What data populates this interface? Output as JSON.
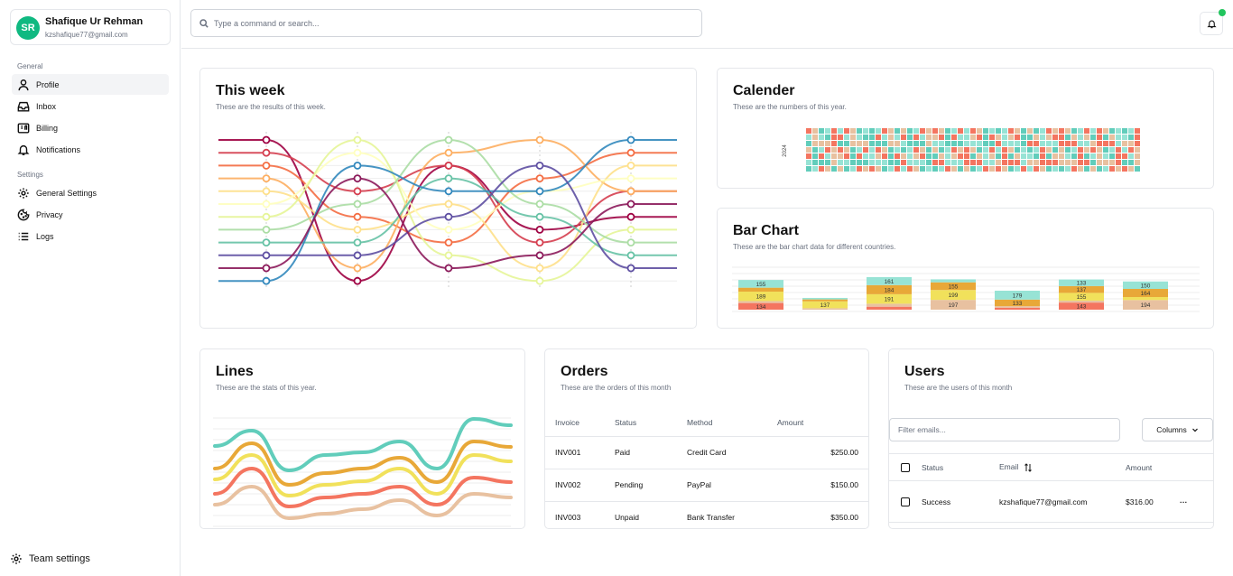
{
  "user": {
    "initials": "SR",
    "name": "Shafique Ur Rehman",
    "email": "kzshafique77@gmail.com"
  },
  "sidebar": {
    "general_label": "General",
    "general_items": [
      {
        "label": "Profile",
        "icon": "user-icon",
        "active": true
      },
      {
        "label": "Inbox",
        "icon": "inbox-icon"
      },
      {
        "label": "Billing",
        "icon": "billing-icon"
      },
      {
        "label": "Notifications",
        "icon": "bell-icon"
      }
    ],
    "settings_label": "Settings",
    "settings_items": [
      {
        "label": "General Settings",
        "icon": "gear-icon"
      },
      {
        "label": "Privacy",
        "icon": "cookie-icon"
      },
      {
        "label": "Logs",
        "icon": "list-icon"
      }
    ],
    "team_settings": "Team settings"
  },
  "topbar": {
    "search_placeholder": "Type a command or search...",
    "notification_dot_color": "#22c55e"
  },
  "this_week": {
    "title": "This week",
    "subtitle": "These are the results of this week."
  },
  "calendar": {
    "title": "Calender",
    "subtitle": "These are the numbers of this year.",
    "year_label": "2024"
  },
  "bar_chart": {
    "title": "Bar Chart",
    "subtitle": "These are the bar chart data for different countries."
  },
  "lines": {
    "title": "Lines",
    "subtitle": "These are the stats of this year."
  },
  "orders": {
    "title": "Orders",
    "subtitle": "These are the orders of this month",
    "columns": [
      "Invoice",
      "Status",
      "Method",
      "Amount"
    ],
    "rows": [
      [
        "INV001",
        "Paid",
        "Credit Card",
        "$250.00"
      ],
      [
        "INV002",
        "Pending",
        "PayPal",
        "$150.00"
      ],
      [
        "INV003",
        "Unpaid",
        "Bank Transfer",
        "$350.00"
      ]
    ]
  },
  "users": {
    "title": "Users",
    "subtitle": "These are the users of this month",
    "filter_placeholder": "Filter emails...",
    "columns_button": "Columns",
    "columns": [
      "Status",
      "Email",
      "Amount"
    ],
    "rows": [
      {
        "status": "Success",
        "email": "kzshafique77@gmail.com",
        "amount": "$316.00",
        "menu": "···"
      }
    ]
  },
  "chart_data": [
    {
      "type": "line",
      "chart": "bump",
      "x": [
        "1",
        "2",
        "3",
        "4",
        "5"
      ],
      "ranks": 12,
      "series": [
        {
          "color": "#9e0142",
          "values": [
            1,
            12,
            3,
            8,
            7
          ]
        },
        {
          "color": "#d53e4f",
          "values": [
            2,
            5,
            3,
            9,
            5
          ]
        },
        {
          "color": "#f46d43",
          "values": [
            3,
            7,
            9,
            4,
            2
          ]
        },
        {
          "color": "#fdae61",
          "values": [
            4,
            11,
            2,
            1,
            5
          ]
        },
        {
          "color": "#fee08b",
          "values": [
            5,
            8,
            6,
            11,
            3
          ]
        },
        {
          "color": "#ffffbf",
          "values": [
            6,
            2,
            8,
            5,
            4
          ]
        },
        {
          "color": "#e6f598",
          "values": [
            7,
            1,
            10,
            12,
            8
          ]
        },
        {
          "color": "#abdda4",
          "values": [
            8,
            6,
            1,
            6,
            9
          ]
        },
        {
          "color": "#66c2a5",
          "values": [
            9,
            9,
            4,
            7,
            10
          ]
        },
        {
          "color": "#3288bd",
          "values": [
            12,
            3,
            5,
            5,
            1
          ]
        },
        {
          "color": "#5e4fa2",
          "values": [
            10,
            10,
            7,
            3,
            11
          ]
        },
        {
          "color": "#8c1a5b",
          "values": [
            11,
            4,
            11,
            10,
            6
          ]
        }
      ]
    },
    {
      "type": "heatmap",
      "chart": "calendar",
      "year": "2024",
      "colors": [
        "#f47560",
        "#e8c1a0",
        "#61cdbb",
        "#97e3d5"
      ]
    },
    {
      "type": "bar",
      "stacked": true,
      "categories": [
        "1",
        "2",
        "3",
        "4",
        "5",
        "6",
        "7"
      ],
      "series": [
        {
          "color": "#f47560",
          "values": [
            134,
            0,
            60,
            0,
            40,
            143,
            0
          ]
        },
        {
          "color": "#e8c1a0",
          "values": [
            40,
            30,
            60,
            197,
            30,
            40,
            194
          ]
        },
        {
          "color": "#f1e15b",
          "values": [
            189,
            137,
            191,
            199,
            0,
            155,
            60
          ]
        },
        {
          "color": "#e8a838",
          "values": [
            80,
            40,
            184,
            155,
            133,
            137,
            164
          ]
        },
        {
          "color": "#97e3d5",
          "values": [
            155,
            30,
            161,
            60,
            179,
            133,
            150
          ]
        }
      ],
      "labels": [
        [
          "134",
          "",
          "189",
          "",
          "155"
        ],
        [
          "",
          "",
          "137",
          "",
          ""
        ],
        [
          "",
          "",
          "191",
          "184",
          "161"
        ],
        [
          "",
          "197",
          "199",
          "155",
          ""
        ],
        [
          "",
          "",
          "",
          "133",
          "179"
        ],
        [
          "143",
          "",
          "155",
          "137",
          "133"
        ],
        [
          "",
          "194",
          "",
          "164",
          "150"
        ]
      ]
    },
    {
      "type": "line",
      "chart": "smooth",
      "series": [
        {
          "color": "#61cdbb",
          "values": [
            65,
            82,
            38,
            55,
            58,
            70,
            40,
            95,
            88
          ]
        },
        {
          "color": "#e8a838",
          "values": [
            40,
            68,
            22,
            35,
            40,
            52,
            25,
            70,
            64
          ]
        },
        {
          "color": "#f1e15b",
          "values": [
            28,
            55,
            10,
            22,
            26,
            40,
            12,
            55,
            48
          ]
        },
        {
          "color": "#f47560",
          "values": [
            12,
            40,
            -2,
            8,
            12,
            20,
            0,
            30,
            25
          ]
        },
        {
          "color": "#e8c1a0",
          "values": [
            0,
            20,
            -15,
            -10,
            -5,
            5,
            -12,
            12,
            8
          ]
        }
      ]
    }
  ]
}
